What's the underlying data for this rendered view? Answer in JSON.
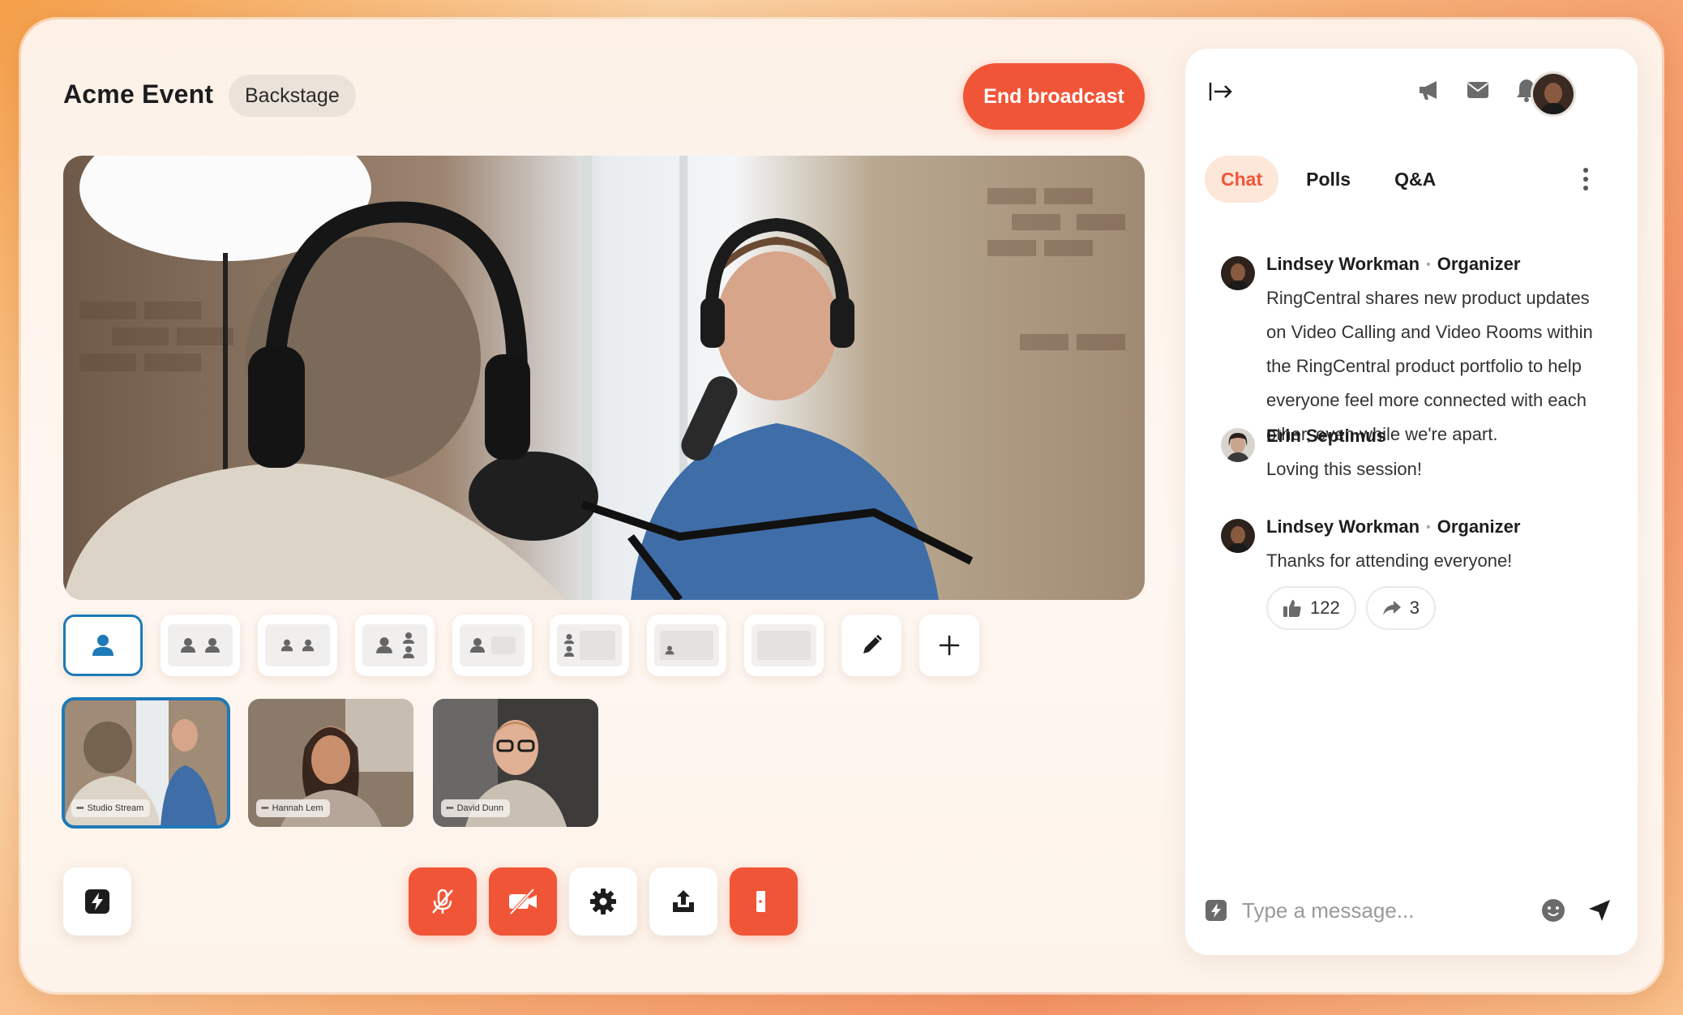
{
  "header": {
    "title": "Acme Event",
    "badge": "Backstage",
    "end_label": "End broadcast"
  },
  "layout_options": [
    "single-speaker",
    "two-speakers",
    "two-speakers-small",
    "three-speakers",
    "speaker-with-screen",
    "stacked-with-screen",
    "small-speaker-screen",
    "screen-only",
    "edit",
    "add"
  ],
  "thumbnails": [
    {
      "label": "Studio Stream",
      "active": true
    },
    {
      "label": "Hannah Lem",
      "active": false
    },
    {
      "label": "David Dunn",
      "active": false
    }
  ],
  "controls": [
    "mute-mic",
    "stop-video",
    "settings",
    "share",
    "leave"
  ],
  "panel": {
    "tabs": [
      "Chat",
      "Polls",
      "Q&A"
    ],
    "active_tab": "Chat",
    "icons": [
      "collapse-panel-icon",
      "megaphone-icon",
      "mail-icon",
      "bell-icon"
    ],
    "messages": [
      {
        "author": "Lindsey Workman",
        "role": "Organizer",
        "text": "RingCentral shares new product updates on Video Calling and Video Rooms within the RingCentral product portfolio to help everyone feel more connected with each other, even while we're apart."
      },
      {
        "author": "Erin Septimus",
        "role": "",
        "text": "Loving this session!"
      },
      {
        "author": "Lindsey Workman",
        "role": "Organizer",
        "text": "Thanks for attending everyone!",
        "reactions": {
          "likes": "122",
          "shares": "3"
        }
      }
    ],
    "composer_placeholder": "Type a message..."
  },
  "colors": {
    "accent": "#f15537",
    "selection": "#1e79b7",
    "tab_bg": "#fde7d9"
  }
}
